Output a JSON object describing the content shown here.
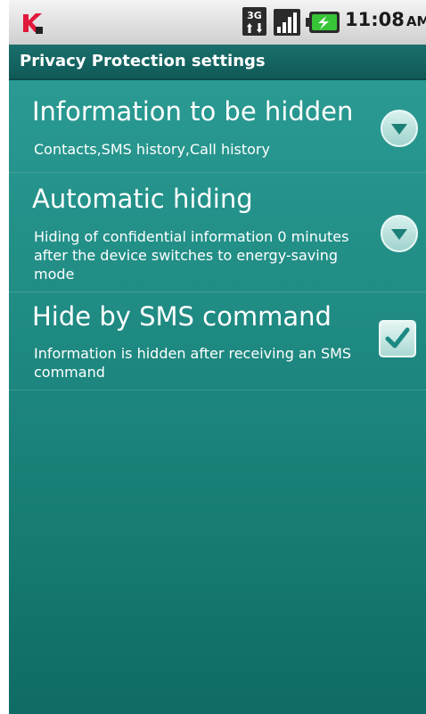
{
  "status_bar": {
    "time": "11:08",
    "ampm": "AM",
    "network_type": "3G",
    "icons": [
      "kaspersky-logo-icon",
      "3g-icon",
      "signal-icon",
      "battery-charging-icon"
    ]
  },
  "header": {
    "title": "Privacy Protection settings"
  },
  "settings": [
    {
      "title": "Information to be hidden",
      "description": "Contacts,SMS history,Call history",
      "control": "dropdown"
    },
    {
      "title": "Automatic hiding",
      "description": "Hiding of confidential information 0 minutes after the device switches to energy-saving mode",
      "control": "dropdown"
    },
    {
      "title": "Hide by SMS command",
      "description": "Information is hidden after receiving an SMS command",
      "control": "checkbox",
      "checked": true
    }
  ],
  "colors": {
    "title_bar": "#14625f",
    "content_top": "#2a9a92",
    "content_bottom": "#0f6b65",
    "text": "#ffffff"
  }
}
